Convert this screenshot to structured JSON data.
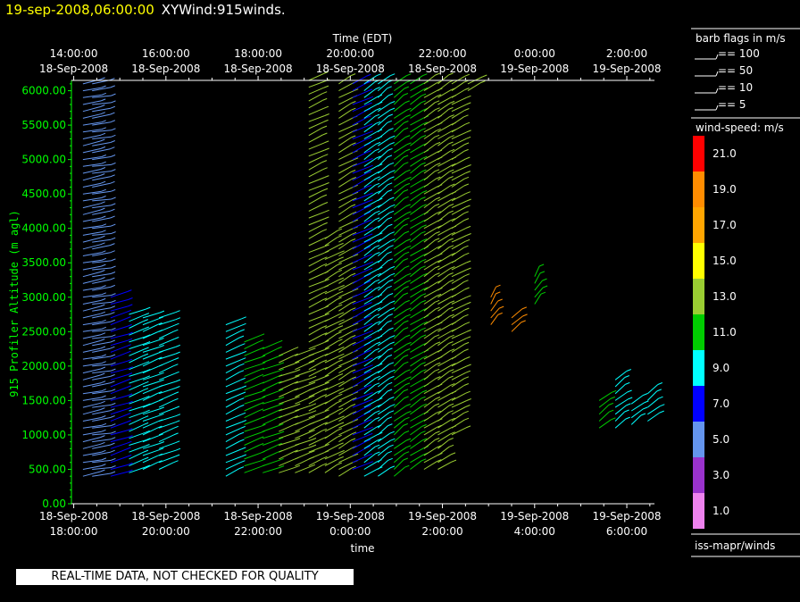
{
  "header": {
    "timestamp": "19-sep-2008,06:00:00",
    "product": "XYWind:915winds."
  },
  "banner": {
    "text": "REAL-TIME DATA, NOT CHECKED FOR QUALITY"
  },
  "chart_data": {
    "type": "wind-barb time-height",
    "title": "",
    "xlabel": "time",
    "x2label": "Time (EDT)",
    "ylabel": "915 Profiler Altitude (m agl)",
    "ylim": [
      0,
      6150
    ],
    "yticks": [
      0,
      500,
      1000,
      1500,
      2000,
      2500,
      3000,
      3500,
      4000,
      4500,
      5000,
      5500,
      6000
    ],
    "ytick_labels": [
      "0.00",
      "500.00",
      "1000.00",
      "1500.00",
      "2000.00",
      "2500.00",
      "3000.00",
      "3500.00",
      "4000.00",
      "4500.00",
      "5000.00",
      "5500.00",
      "6000.00"
    ],
    "x_range_hours": [
      -0.05,
      12.6
    ],
    "bottom_ticks": [
      {
        "h": 0,
        "line1": "18-Sep-2008",
        "line2": "18:00:00"
      },
      {
        "h": 2,
        "line1": "18-Sep-2008",
        "line2": "20:00:00"
      },
      {
        "h": 4,
        "line1": "18-Sep-2008",
        "line2": "22:00:00"
      },
      {
        "h": 6,
        "line1": "19-Sep-2008",
        "line2": "0:00:00"
      },
      {
        "h": 8,
        "line1": "19-Sep-2008",
        "line2": "2:00:00"
      },
      {
        "h": 10,
        "line1": "19-Sep-2008",
        "line2": "4:00:00"
      },
      {
        "h": 12,
        "line1": "19-Sep-2008",
        "line2": "6:00:00"
      }
    ],
    "top_ticks": [
      {
        "h": 0,
        "line1": "14:00:00",
        "line2": "18-Sep-2008"
      },
      {
        "h": 2,
        "line1": "16:00:00",
        "line2": "18-Sep-2008"
      },
      {
        "h": 4,
        "line1": "18:00:00",
        "line2": "18-Sep-2008"
      },
      {
        "h": 6,
        "line1": "20:00:00",
        "line2": "18-Sep-2008"
      },
      {
        "h": 8,
        "line1": "22:00:00",
        "line2": "18-Sep-2008"
      },
      {
        "h": 10,
        "line1": "0:00:00",
        "line2": "19-Sep-2008"
      },
      {
        "h": 12,
        "line1": "2:00:00",
        "line2": "19-Sep-2008"
      }
    ],
    "barb_legend": {
      "title": "barb flags in m/s",
      "items": [
        "== 100",
        "== 50",
        "== 10",
        "== 5"
      ]
    },
    "speed_legend": {
      "title": "wind-speed: m/s",
      "bins": [
        {
          "label": "21.0",
          "color": "#ff0000"
        },
        {
          "label": "19.0",
          "color": "#ff8c00"
        },
        {
          "label": "17.0",
          "color": "#ffa500"
        },
        {
          "label": "15.0",
          "color": "#ffff00"
        },
        {
          "label": "13.0",
          "color": "#9acd32"
        },
        {
          "label": "11.0",
          "color": "#00cc00"
        },
        {
          "label": "9.0",
          "color": "#00ffff"
        },
        {
          "label": "7.0",
          "color": "#0000ff"
        },
        {
          "label": "5.0",
          "color": "#6495ed"
        },
        {
          "label": "3.0",
          "color": "#9932cc"
        },
        {
          "label": "1.0",
          "color": "#ee82ee"
        }
      ]
    },
    "source_label": "iss-mapr/winds",
    "profiles": [
      {
        "h": 0.2,
        "bottom": 400,
        "top": 6150,
        "speed": 4,
        "dir": 250
      },
      {
        "h": 0.4,
        "bottom": 400,
        "top": 6150,
        "speed": 5,
        "dir": 255
      },
      {
        "h": 0.8,
        "bottom": 400,
        "top": 3000,
        "speed": 7,
        "dir": 240
      },
      {
        "h": 1.2,
        "bottom": 450,
        "top": 2750,
        "speed": 8,
        "dir": 235
      },
      {
        "h": 1.5,
        "bottom": 500,
        "top": 2750,
        "speed": 9,
        "dir": 235
      },
      {
        "h": 1.85,
        "bottom": 500,
        "top": 2750,
        "speed": 9,
        "dir": 235
      },
      {
        "h": 3.3,
        "bottom": 400,
        "top": 2600,
        "speed": 8,
        "dir": 230
      },
      {
        "h": 3.7,
        "bottom": 450,
        "top": 2350,
        "speed": 10,
        "dir": 235
      },
      {
        "h": 4.1,
        "bottom": 450,
        "top": 2300,
        "speed": 11,
        "dir": 235
      },
      {
        "h": 4.45,
        "bottom": 450,
        "top": 2200,
        "speed": 12,
        "dir": 235
      },
      {
        "h": 4.8,
        "bottom": 450,
        "top": 2200,
        "speed": 12,
        "dir": 235
      },
      {
        "h": 5.1,
        "bottom": 450,
        "top": 6150,
        "speed": 12,
        "dir": 230
      },
      {
        "h": 5.45,
        "bottom": 450,
        "top": 3900,
        "speed": 13,
        "dir": 225
      },
      {
        "h": 5.75,
        "bottom": 400,
        "top": 6150,
        "speed": 13,
        "dir": 225
      },
      {
        "h": 6.05,
        "bottom": 500,
        "top": 6150,
        "speed": 7,
        "dir": 230
      },
      {
        "h": 6.3,
        "bottom": 400,
        "top": 6150,
        "speed": 8,
        "dir": 220
      },
      {
        "h": 6.6,
        "bottom": 400,
        "top": 6150,
        "speed": 9,
        "dir": 215
      },
      {
        "h": 6.95,
        "bottom": 400,
        "top": 6150,
        "speed": 10,
        "dir": 215
      },
      {
        "h": 7.3,
        "bottom": 500,
        "top": 6150,
        "speed": 11,
        "dir": 220
      },
      {
        "h": 7.6,
        "bottom": 500,
        "top": 6150,
        "speed": 12,
        "dir": 220
      },
      {
        "h": 7.9,
        "bottom": 500,
        "top": 6150,
        "speed": 12,
        "dir": 220
      },
      {
        "h": 8.2,
        "bottom": 1000,
        "top": 6150,
        "speed": 12,
        "dir": 225
      },
      {
        "h": 8.55,
        "bottom": 6000,
        "top": 6150,
        "speed": 13,
        "dir": 225
      },
      {
        "h": 9.05,
        "bottom": 2600,
        "top": 3000,
        "speed": 18,
        "dir": 200
      },
      {
        "h": 9.5,
        "bottom": 2500,
        "top": 2750,
        "speed": 18,
        "dir": 210
      },
      {
        "h": 10.0,
        "bottom": 2900,
        "top": 3300,
        "speed": 11,
        "dir": 200
      },
      {
        "h": 11.4,
        "bottom": 1100,
        "top": 1500,
        "speed": 10,
        "dir": 215
      },
      {
        "h": 11.75,
        "bottom": 1100,
        "top": 1800,
        "speed": 9,
        "dir": 215
      },
      {
        "h": 12.1,
        "bottom": 1150,
        "top": 1500,
        "speed": 9,
        "dir": 215
      },
      {
        "h": 12.45,
        "bottom": 1200,
        "top": 1600,
        "speed": 9,
        "dir": 215
      }
    ]
  }
}
